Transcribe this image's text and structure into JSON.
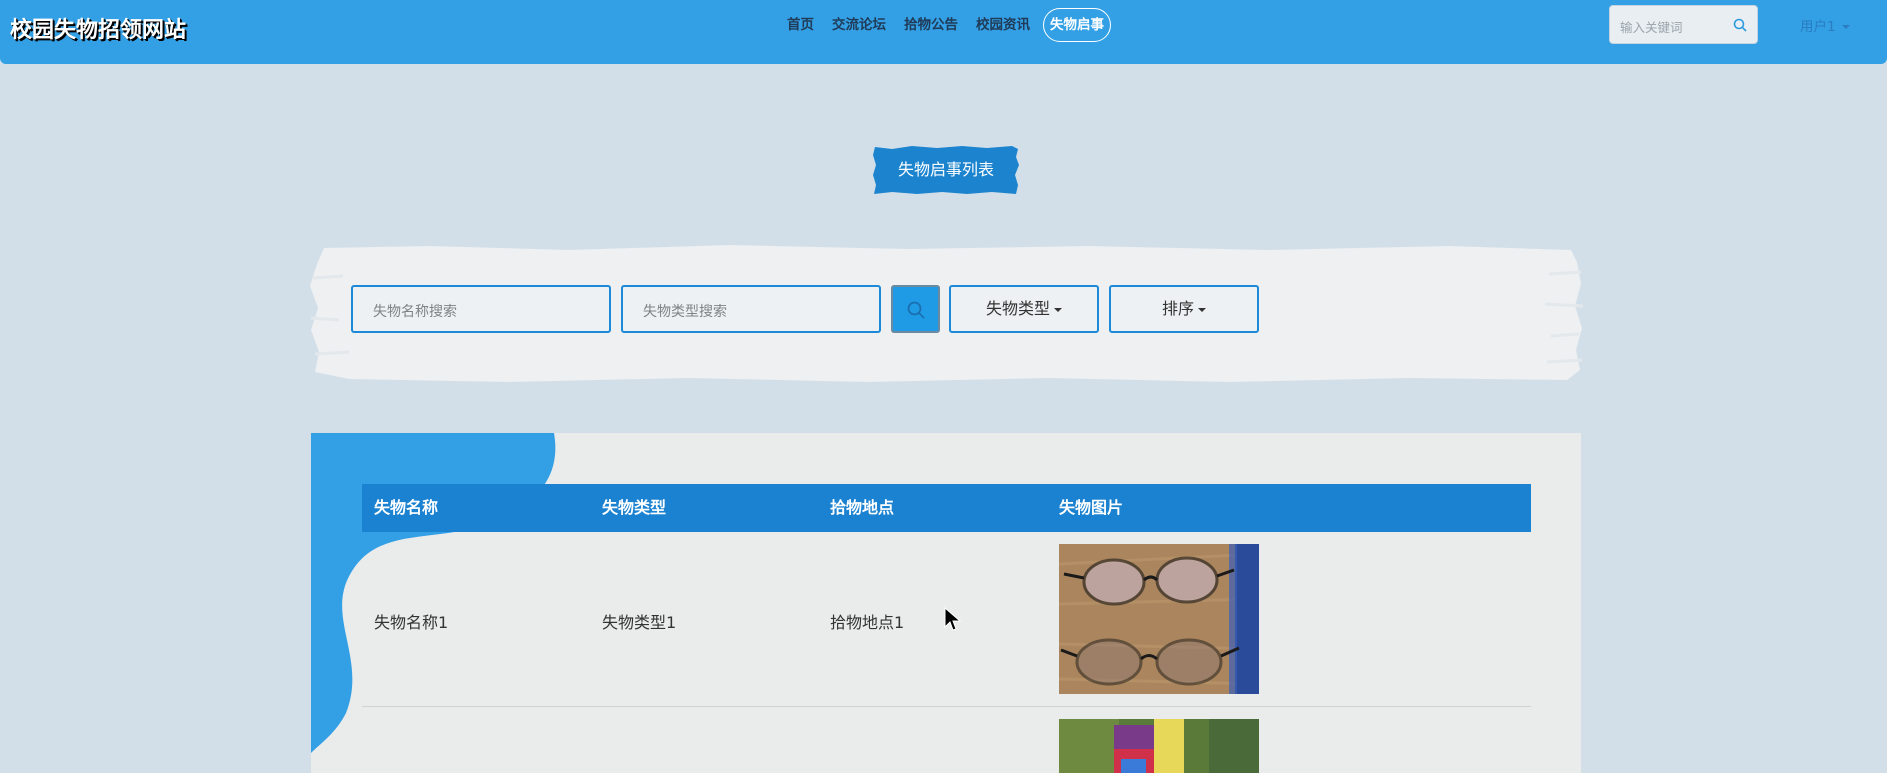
{
  "site": {
    "title": "校园失物招领网站"
  },
  "nav": {
    "items": [
      {
        "label": "首页"
      },
      {
        "label": "交流论坛"
      },
      {
        "label": "拾物公告"
      },
      {
        "label": "校园资讯"
      },
      {
        "label": "失物启事"
      }
    ],
    "active": "失物启事"
  },
  "header": {
    "search_placeholder": "输入关键词",
    "user_label": "用户1"
  },
  "page": {
    "heading": "失物启事列表"
  },
  "filters": {
    "name_placeholder": "失物名称搜索",
    "type_placeholder": "失物类型搜索",
    "type_dropdown": "失物类型",
    "sort_dropdown": "排序"
  },
  "table": {
    "headers": [
      "失物名称",
      "失物类型",
      "拾物地点",
      "失物图片"
    ],
    "rows": [
      {
        "name": "失物名称1",
        "type": "失物类型1",
        "location": "拾物地点1",
        "image": "eyeglasses-photo"
      },
      {
        "name": "",
        "type": "",
        "location": "",
        "image": "cup-photo"
      }
    ]
  },
  "colors": {
    "primary": "#33a0e6",
    "table_header": "#1a82d1",
    "page_bg": "#d3dfe8"
  },
  "icons": {
    "search": "search-icon",
    "caret": "caret-down-icon"
  }
}
